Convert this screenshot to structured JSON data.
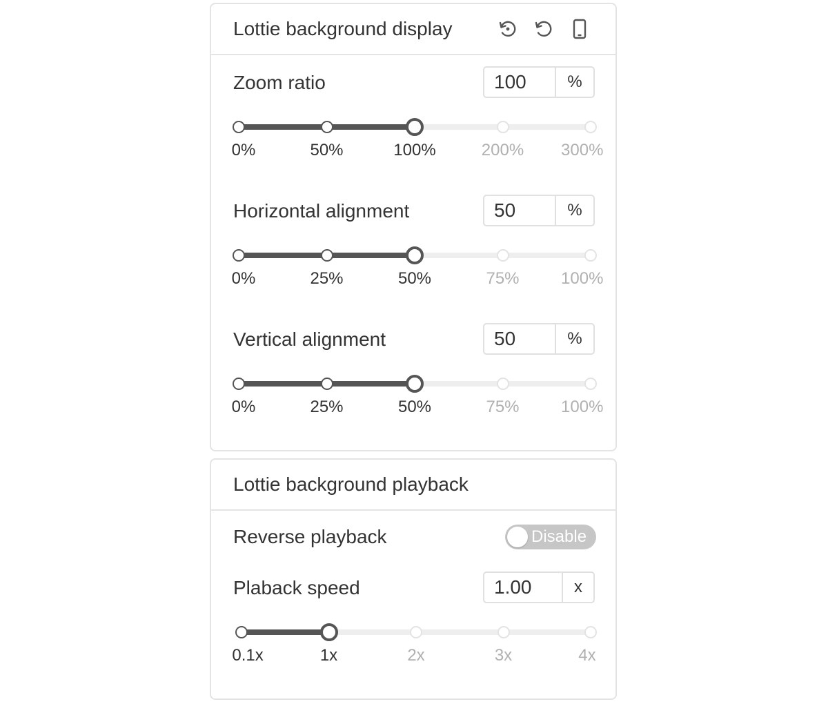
{
  "display_panel": {
    "title": "Lottie background display",
    "icons": [
      "history-reset-icon",
      "undo-icon",
      "mobile-preview-icon"
    ],
    "zoom": {
      "label": "Zoom ratio",
      "value": "100",
      "unit": "%",
      "marks": [
        "0%",
        "50%",
        "100%",
        "200%",
        "300%"
      ],
      "mark_values": [
        0,
        50,
        100,
        200,
        300
      ],
      "current": 100,
      "max": 300
    },
    "horizontal": {
      "label": "Horizontal alignment",
      "value": "50",
      "unit": "%",
      "marks": [
        "0%",
        "25%",
        "50%",
        "75%",
        "100%"
      ],
      "mark_values": [
        0,
        25,
        50,
        75,
        100
      ],
      "current": 50,
      "max": 100
    },
    "vertical": {
      "label": "Vertical alignment",
      "value": "50",
      "unit": "%",
      "marks": [
        "0%",
        "25%",
        "50%",
        "75%",
        "100%"
      ],
      "mark_values": [
        0,
        25,
        50,
        75,
        100
      ],
      "current": 50,
      "max": 100
    }
  },
  "playback_panel": {
    "title": "Lottie background playback",
    "reverse": {
      "label": "Reverse playback",
      "toggle_text": "Disable",
      "enabled": false
    },
    "speed": {
      "label": "Plaback speed",
      "value": "1.00",
      "unit": "x",
      "marks": [
        "0.1x",
        "1x",
        "2x",
        "3x",
        "4x"
      ],
      "mark_values": [
        0.1,
        1,
        2,
        3,
        4
      ],
      "current": 1,
      "max": 4
    }
  },
  "colors": {
    "active": "#555555",
    "inactive": "#eeeeee",
    "border": "#e4e4e4",
    "text": "#333333",
    "muted": "#b0b0b0"
  }
}
